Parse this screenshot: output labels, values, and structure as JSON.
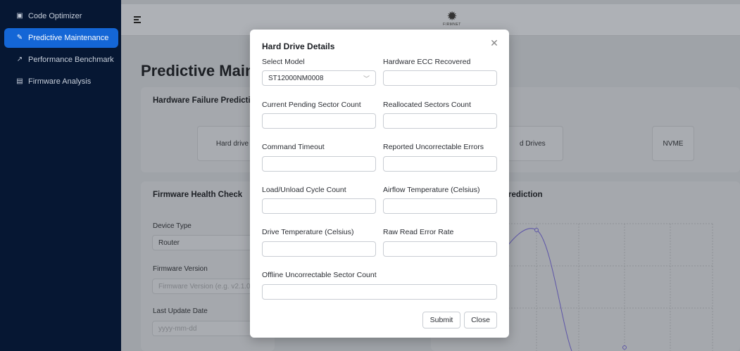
{
  "sidebar": {
    "items": [
      {
        "label": "Code Optimizer",
        "icon": "code-icon"
      },
      {
        "label": "Predictive Maintenance",
        "icon": "wrench-icon"
      },
      {
        "label": "Performance Benchmark",
        "icon": "chart-icon"
      },
      {
        "label": "Firmware Analysis",
        "icon": "chip-icon"
      }
    ]
  },
  "header": {
    "logo_text": "FIRMNET"
  },
  "page": {
    "title": "Predictive Maint",
    "failure_card": {
      "title": "Hardware Failure Predictio",
      "chips": [
        "Hard drive",
        "d Drives",
        "NVME"
      ]
    },
    "health_card": {
      "title": "Firmware Health Check",
      "device_type_label": "Device Type",
      "device_type_value": "Router",
      "firmware_version_label": "Firmware Version",
      "firmware_version_placeholder": "Firmware Version (e.g. v2.1.0)",
      "last_update_label": "Last Update Date",
      "last_update_placeholder": "yyyy-mm-dd"
    },
    "prediction_card": {
      "title": "rediction"
    }
  },
  "modal": {
    "title": "Hard Drive Details",
    "fields": {
      "select_model": {
        "label": "Select Model",
        "value": "ST12000NM0008"
      },
      "hardware_ecc": {
        "label": "Hardware ECC Recovered",
        "value": ""
      },
      "pending_sector": {
        "label": "Current Pending Sector Count",
        "value": ""
      },
      "reallocated": {
        "label": "Reallocated Sectors Count",
        "value": ""
      },
      "command_timeout": {
        "label": "Command Timeout",
        "value": ""
      },
      "reported_uncorrectable": {
        "label": "Reported Uncorrectable Errors",
        "value": ""
      },
      "load_unload": {
        "label": "Load/Unload Cycle Count",
        "value": ""
      },
      "airflow_temp": {
        "label": "Airflow Temperature (Celsius)",
        "value": ""
      },
      "drive_temp": {
        "label": "Drive Temperature (Celsius)",
        "value": ""
      },
      "raw_read_error": {
        "label": "Raw Read Error Rate",
        "value": ""
      },
      "offline_uncorrectable": {
        "label": "Offline Uncorrectable Sector Count",
        "value": ""
      }
    },
    "submit_label": "Submit",
    "close_label": "Close"
  },
  "colors": {
    "sidebar_bg": "#061733",
    "active": "#1466d6",
    "chart_line": "#6b5fc4"
  }
}
